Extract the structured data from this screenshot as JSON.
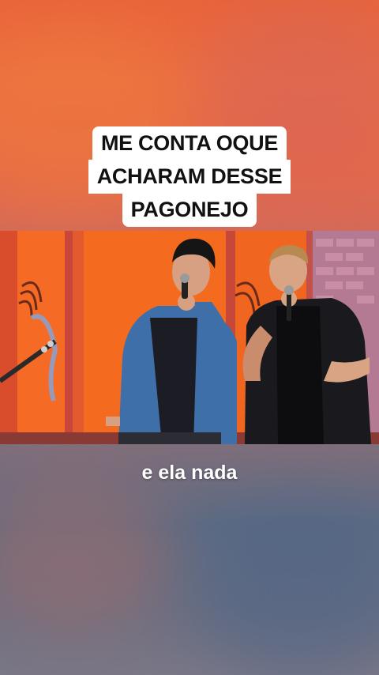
{
  "caption": {
    "line1": "ME CONTA OQUE",
    "line2": "ACHARAM DESSE",
    "line3": "PAGONEJO"
  },
  "subtitle": "e ela nada",
  "colors": {
    "background_top": "#e8643a",
    "background_bottom": "#5b6b83",
    "caption_bg": "#ffffff",
    "caption_text": "#111111",
    "subtitle_text": "#ffffff"
  }
}
